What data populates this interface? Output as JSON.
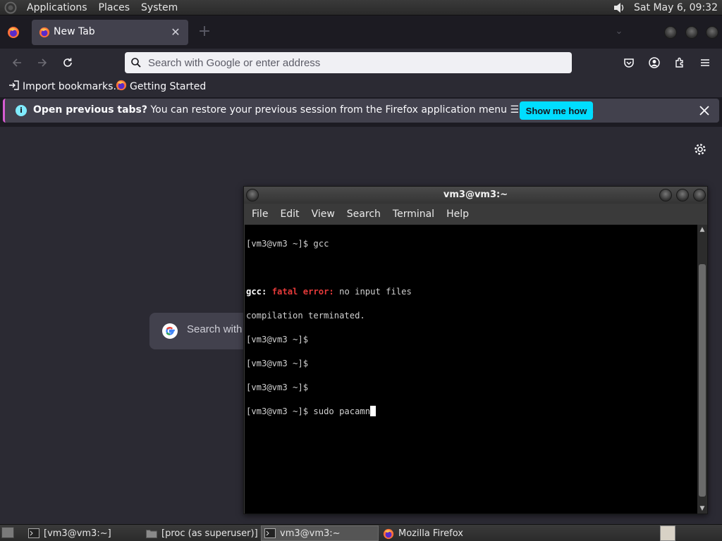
{
  "top_panel": {
    "menus": [
      "Applications",
      "Places",
      "System"
    ],
    "clock": "Sat May  6, 09:32",
    "volume_icon": "speaker-icon"
  },
  "firefox": {
    "tab": {
      "title": "New Tab",
      "icon": "firefox-icon",
      "close_icon": "close-icon"
    },
    "new_tab_icon": "plus-icon",
    "url_placeholder": "Search with Google or enter address",
    "toolbar_icons": [
      "pocket-icon",
      "account-icon",
      "extensions-icon",
      "menu-icon"
    ],
    "bookmarks": [
      "Import bookmarks…",
      "Getting Started"
    ],
    "notification": {
      "bold": "Open previous tabs?",
      "text": " You can restore your previous session from the Firefox application menu ☰, under History.",
      "button": "Show me how"
    },
    "page_search": "Search with"
  },
  "terminal": {
    "title": "vm3@vm3:~",
    "menu": [
      "File",
      "Edit",
      "View",
      "Search",
      "Terminal",
      "Help"
    ],
    "lines": [
      {
        "prompt": "[vm3@vm3 ~]$ ",
        "cmd": "gcc"
      },
      {
        "blank": ""
      },
      {
        "err_prog": "gcc:",
        "err_label": "fatal error:",
        "err_msg": " no input files"
      },
      {
        "text": "compilation terminated."
      },
      {
        "prompt": "[vm3@vm3 ~]$",
        "cmd": ""
      },
      {
        "prompt": "[vm3@vm3 ~]$",
        "cmd": ""
      },
      {
        "prompt": "[vm3@vm3 ~]$",
        "cmd": ""
      },
      {
        "prompt": "[vm3@vm3 ~]$ ",
        "cmd": "sudo pacamn"
      }
    ]
  },
  "taskbar": {
    "items": [
      {
        "label": "[vm3@vm3:~]",
        "icon": "terminal-icon"
      },
      {
        "label": "[proc (as superuser)]",
        "icon": "folder-icon"
      },
      {
        "label": "vm3@vm3:~",
        "icon": "terminal-icon"
      },
      {
        "label": "Mozilla Firefox",
        "icon": "firefox-icon"
      }
    ]
  }
}
